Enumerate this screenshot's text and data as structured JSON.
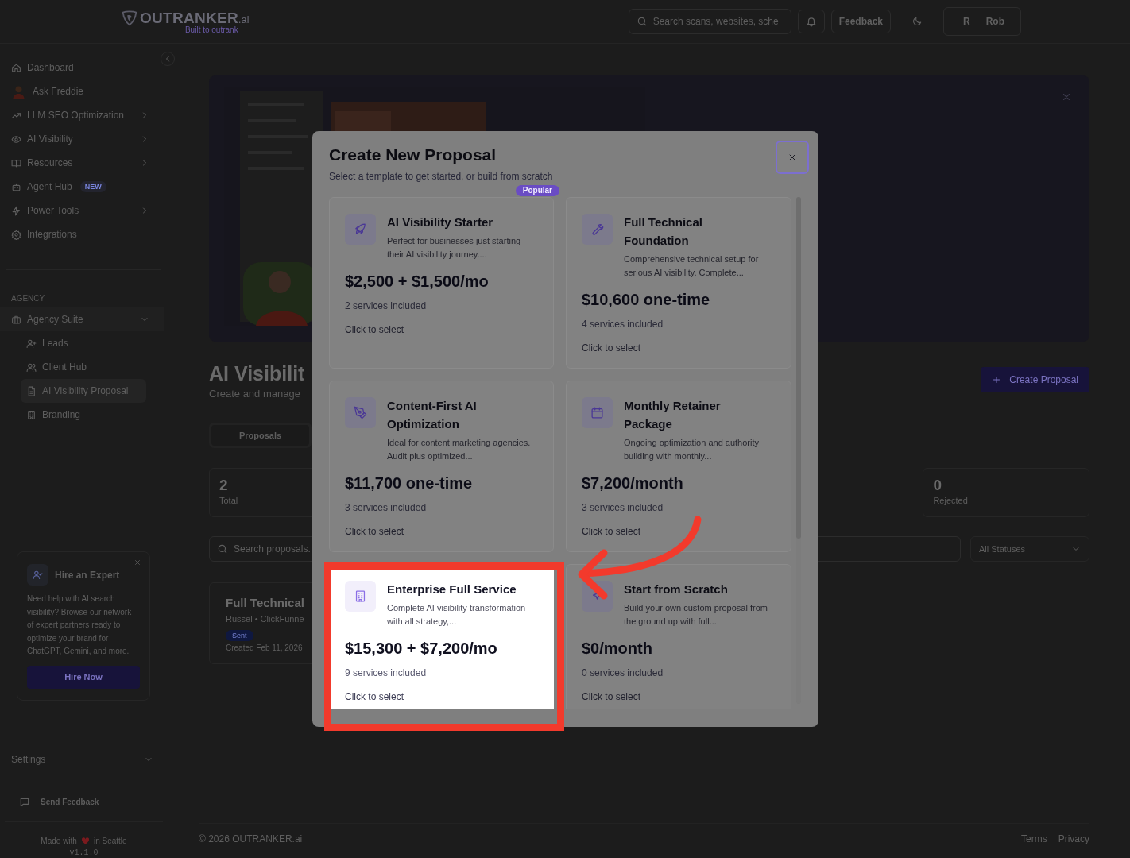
{
  "header": {
    "logo": {
      "wordmark": "OUTRANKER",
      "suffix": ".ai",
      "tagline": "Built to outrank"
    },
    "search": {
      "placeholder": "Search scans, websites, sche"
    },
    "feedback": "Feedback",
    "user": {
      "initial": "R",
      "name": "Rob"
    }
  },
  "sidebar": {
    "items": [
      {
        "label": "Dashboard",
        "submenu": false
      },
      {
        "label": "Ask Freddie",
        "submenu": false
      },
      {
        "label": "LLM SEO Optimization",
        "submenu": true
      },
      {
        "label": "AI Visibility",
        "submenu": true
      },
      {
        "label": "Resources",
        "submenu": true
      },
      {
        "label": "Agent Hub",
        "submenu": false,
        "badge": "NEW"
      },
      {
        "label": "Power Tools",
        "submenu": true
      },
      {
        "label": "Integrations",
        "submenu": false
      }
    ],
    "agency": {
      "heading": "AGENCY",
      "label": "Agency Suite",
      "expanded": true,
      "children": [
        {
          "label": "Leads",
          "selected": false
        },
        {
          "label": "Client Hub",
          "selected": false
        },
        {
          "label": "AI Visibility Proposal",
          "selected": true
        },
        {
          "label": "Branding",
          "selected": false
        }
      ]
    },
    "promo": {
      "title": "Hire an Expert",
      "text": "Need help with AI search visibility? Browse our network of expert partners ready to optimize your brand for ChatGPT, Gemini, and more.",
      "button": "Hire Now"
    },
    "settings": "Settings",
    "send_feedback": "Send Feedback",
    "made_with": {
      "before": "Made with",
      "after": "in Seattle"
    },
    "version": "v1.1.0"
  },
  "page": {
    "title": "AI Visibilit",
    "subtitle": "Create and manage",
    "create_button": "Create Proposal",
    "tabs": [
      {
        "label": "Proposals",
        "selected": true
      }
    ],
    "stats": [
      {
        "value": "2",
        "label": "Total"
      },
      {
        "value": "0",
        "label": "Rejected"
      }
    ],
    "search": {
      "placeholder": "Search proposals."
    },
    "status_filter": "All Statuses",
    "proposals": [
      {
        "title": "Full Technical",
        "meta": "Russel • ClickFunne",
        "status": "Sent",
        "created": "Created Feb 11, 2026"
      }
    ]
  },
  "footer": {
    "copyright": "© 2026 OUTRANKER.ai",
    "links": [
      "Terms",
      "Privacy"
    ]
  },
  "modal": {
    "title": "Create New Proposal",
    "subtitle": "Select a template to get started, or build from scratch",
    "templates": [
      {
        "title": "AI Visibility Starter",
        "description": "Perfect for businesses just starting their AI visibility journey....",
        "price": "$2,500 + $1,500/mo",
        "services": "2 services included",
        "action": "Click to select",
        "badge": "Popular",
        "highlighted": false
      },
      {
        "title": "Full Technical Foundation",
        "description": "Comprehensive technical setup for serious AI visibility. Complete...",
        "price": "$10,600 one-time",
        "services": "4 services included",
        "action": "Click to select",
        "highlighted": false
      },
      {
        "title": "Content-First AI Optimization",
        "description": "Ideal for content marketing agencies. Audit plus optimized...",
        "price": "$11,700 one-time",
        "services": "3 services included",
        "action": "Click to select",
        "highlighted": false
      },
      {
        "title": "Monthly Retainer Package",
        "description": "Ongoing optimization and authority building with monthly...",
        "price": "$7,200/month",
        "services": "3 services included",
        "action": "Click to select",
        "highlighted": false
      },
      {
        "title": "Enterprise Full Service",
        "description": "Complete AI visibility transformation with all strategy,...",
        "price": "$15,300 + $7,200/mo",
        "services": "9 services included",
        "action": "Click to select",
        "highlighted": true
      },
      {
        "title": "Start from Scratch",
        "description": "Build your own custom proposal from the ground up with full...",
        "price": "$0/month",
        "services": "0 services included",
        "action": "Click to select",
        "highlighted": false
      }
    ]
  }
}
